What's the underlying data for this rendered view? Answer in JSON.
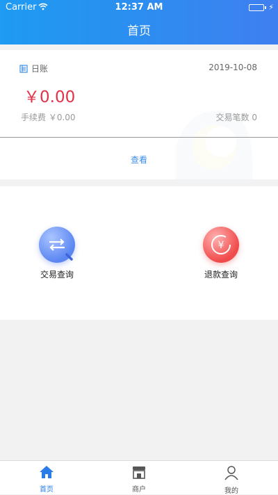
{
  "status_bar": {
    "carrier": "Carrier",
    "time": "12:37 AM"
  },
  "nav": {
    "title": "首页"
  },
  "daily_card": {
    "label": "日账",
    "date": "2019-10-08",
    "amount": "￥0.00",
    "fee": "手续费  ￥0.00",
    "count": "交易笔数 0",
    "view_label": "查看"
  },
  "actions": [
    {
      "label": "交易查询",
      "icon": "transaction-query-icon"
    },
    {
      "label": "退款查询",
      "icon": "refund-query-icon"
    }
  ],
  "tabbar": {
    "items": [
      {
        "label": "首页",
        "icon": "home-icon",
        "active": true
      },
      {
        "label": "商户",
        "icon": "store-icon",
        "active": false
      },
      {
        "label": "我的",
        "icon": "profile-icon",
        "active": false
      }
    ]
  },
  "colors": {
    "accent": "#3b8de8",
    "amount": "#e0334a",
    "tab_active": "#2a7de8",
    "tab_inactive": "#555555"
  }
}
